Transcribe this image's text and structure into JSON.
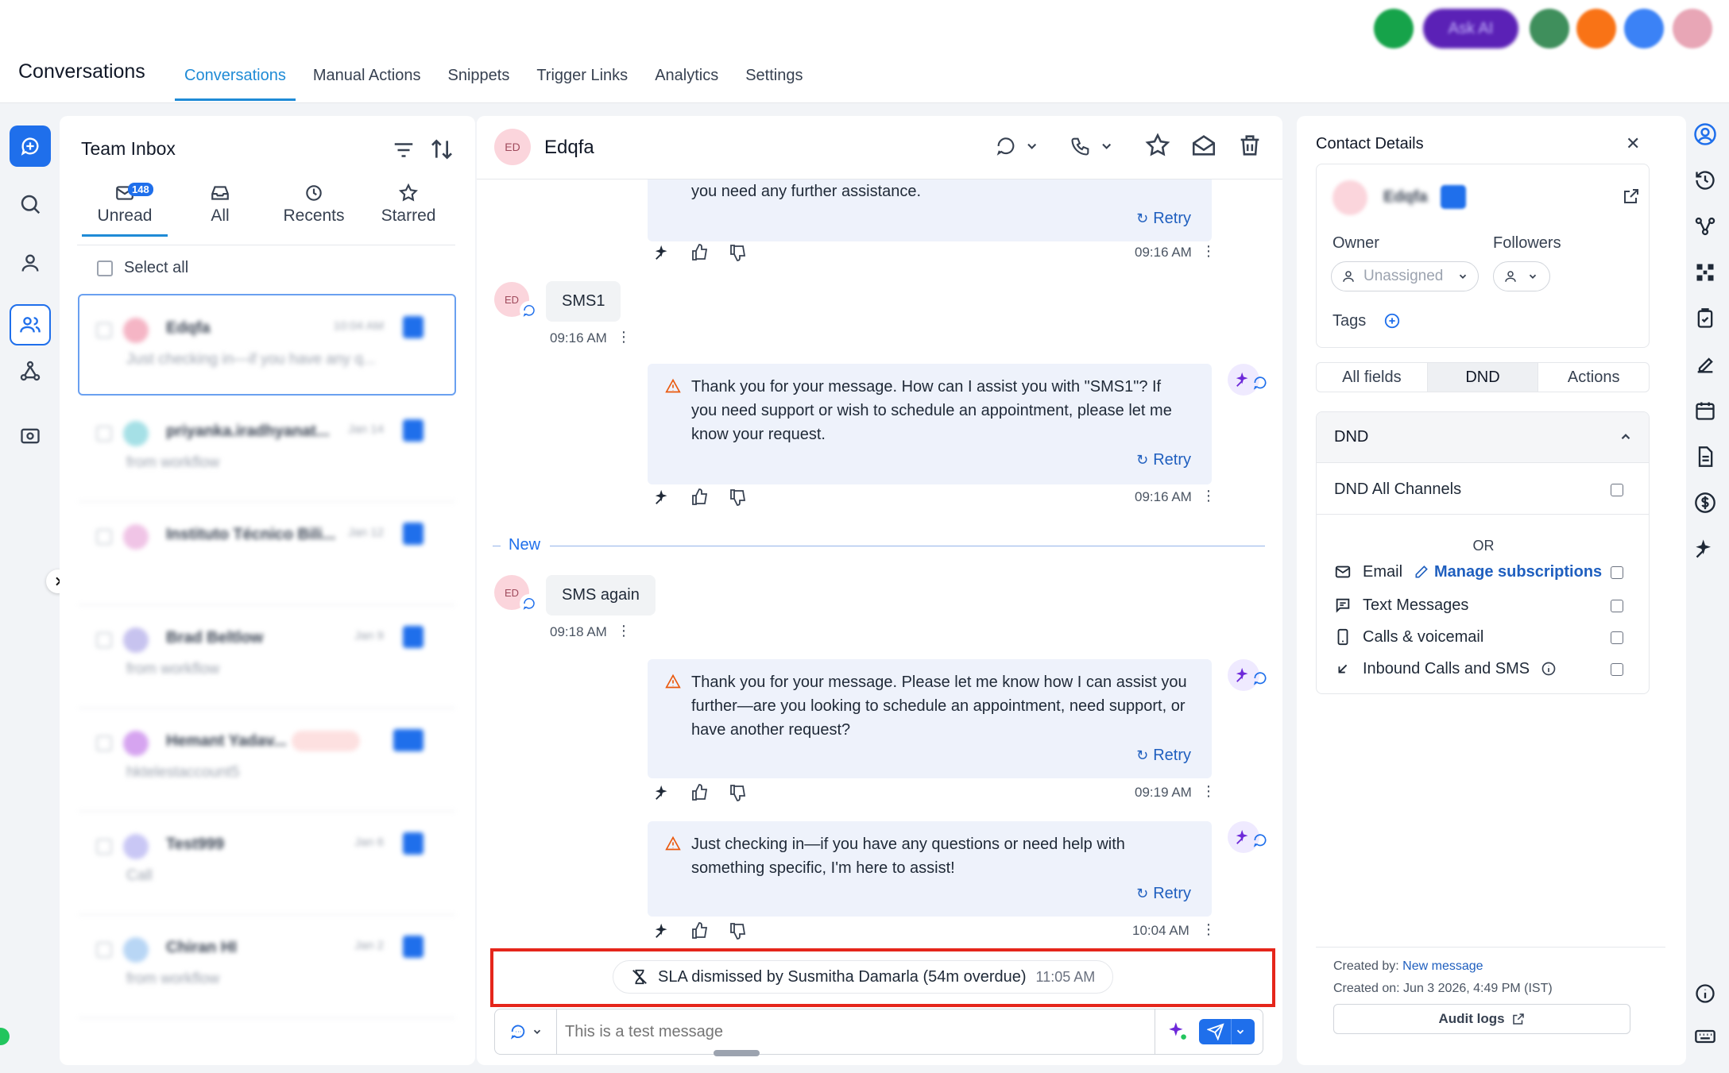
{
  "app": {
    "title": "Conversations"
  },
  "nav_tabs": [
    "Conversations",
    "Manual Actions",
    "Snippets",
    "Trigger Links",
    "Analytics",
    "Settings"
  ],
  "topbar": {
    "ask_ai_label": "Ask AI"
  },
  "inbox": {
    "title": "Team Inbox",
    "unread_count": "148",
    "tabs": [
      "Unread",
      "All",
      "Recents",
      "Starred"
    ],
    "select_all": "Select all",
    "rows": [
      {
        "name": "Edqfa",
        "date": "10:04 AM",
        "preview": "Just checking in—if you have any q..."
      },
      {
        "name": "priyanka.iradhyanat...",
        "date": "Jan 14",
        "preview": "from workflow"
      },
      {
        "name": "Instituto Técnico Bili...",
        "date": "Jan 12",
        "preview": ""
      },
      {
        "name": "Brad Beltlow",
        "date": "Jan 9",
        "preview": "from workflow"
      },
      {
        "name": "Hemant Yadav...",
        "date": "",
        "preview": "hktelestaccount5"
      },
      {
        "name": "Test999",
        "date": "Jan 6",
        "preview": "Call"
      },
      {
        "name": "Chiran HI",
        "date": "Jan 2",
        "preview": "from workflow"
      }
    ]
  },
  "chat": {
    "contact_initials": "ED",
    "contact_name": "Edqfa",
    "messages": [
      {
        "text": "you need any further assistance.",
        "retry": "Retry",
        "time": "09:16 AM"
      },
      {
        "in_text": "SMS1",
        "time": "09:16 AM"
      },
      {
        "text": "Thank you for your message. How can I assist you with \"SMS1\"? If you need support or wish to schedule an appointment, please let me know your request.",
        "retry": "Retry",
        "time": "09:16 AM"
      },
      {
        "divider": "New"
      },
      {
        "in_text": "SMS again",
        "time": "09:18 AM"
      },
      {
        "text": "Thank you for your message. Please let me know how I can assist you further—are you looking to schedule an appointment, need support, or have another request?",
        "retry": "Retry",
        "time": "09:19 AM"
      },
      {
        "text": "Just checking in—if you have any questions or need help with something specific, I'm here to assist!",
        "retry": "Retry",
        "time": "10:04 AM"
      }
    ],
    "sla_text": "SLA dismissed by Susmitha Damarla (54m overdue)",
    "sla_time": "11:05 AM",
    "composer_placeholder": "This is a test message"
  },
  "contact": {
    "header": "Contact Details",
    "name": "Edqfa",
    "owner_label": "Owner",
    "owner_value": "Unassigned",
    "followers_label": "Followers",
    "tags_label": "Tags",
    "tabs": [
      "All fields",
      "DND",
      "Actions"
    ],
    "dnd_title": "DND",
    "dnd_all": "DND All Channels",
    "or": "OR",
    "email": "Email",
    "manage_subscriptions": "Manage subscriptions",
    "text_messages": "Text Messages",
    "calls": "Calls & voicemail",
    "inbound": "Inbound Calls and SMS",
    "created_by_label": "Created by:",
    "created_by_value": "New message",
    "created_on": "Created on: Jun 3 2026, 4:49 PM (IST)",
    "audit_logs": "Audit logs"
  },
  "colors": {
    "accent": "#1f8bd6",
    "sla_border": "#e5261b",
    "ai_purple": "#6d28d9"
  }
}
